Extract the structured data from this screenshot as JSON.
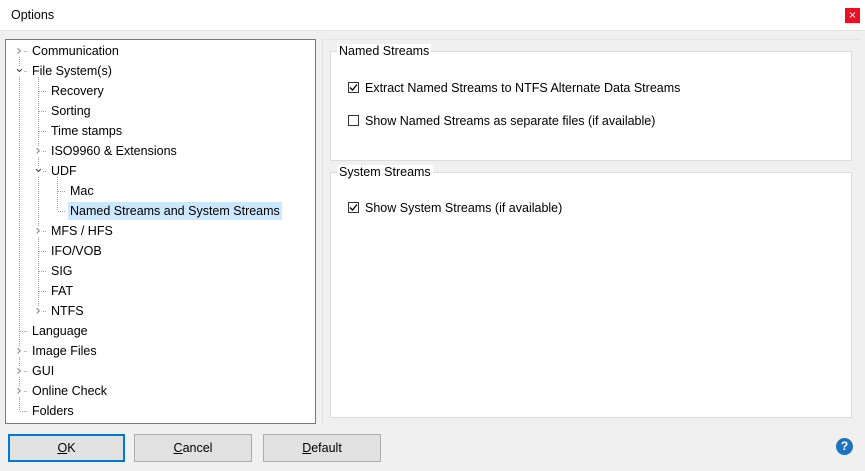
{
  "window": {
    "title": "Options",
    "close_glyph": "×"
  },
  "tree": {
    "nodes": [
      {
        "label": "Communication",
        "expander": "collapsed"
      },
      {
        "label": "File System(s)",
        "expander": "expanded"
      },
      {
        "label": "Recovery",
        "expander": "none"
      },
      {
        "label": "Sorting",
        "expander": "none"
      },
      {
        "label": "Time stamps",
        "expander": "none"
      },
      {
        "label": "ISO9960 & Extensions",
        "expander": "collapsed"
      },
      {
        "label": "UDF",
        "expander": "expanded"
      },
      {
        "label": "Mac",
        "expander": "none"
      },
      {
        "label": "Named Streams and System Streams",
        "expander": "none",
        "selected": true
      },
      {
        "label": "MFS / HFS",
        "expander": "collapsed"
      },
      {
        "label": "IFO/VOB",
        "expander": "none"
      },
      {
        "label": "SIG",
        "expander": "none"
      },
      {
        "label": "FAT",
        "expander": "none"
      },
      {
        "label": "NTFS",
        "expander": "collapsed"
      },
      {
        "label": "Language",
        "expander": "none"
      },
      {
        "label": "Image Files",
        "expander": "collapsed"
      },
      {
        "label": "GUI",
        "expander": "collapsed"
      },
      {
        "label": "Online Check",
        "expander": "collapsed"
      },
      {
        "label": "Folders",
        "expander": "none"
      }
    ]
  },
  "named_streams": {
    "title": "Named Streams",
    "extract": {
      "label": "Extract Named Streams to NTFS Alternate Data Streams",
      "checked": true
    },
    "separate": {
      "label": "Show Named Streams as separate files (if available)",
      "checked": false
    }
  },
  "system_streams": {
    "title": "System Streams",
    "show": {
      "label": "Show System Streams (if available)",
      "checked": true
    }
  },
  "buttons": {
    "ok": {
      "accel": "O",
      "rest": "K"
    },
    "cancel": {
      "accel": "C",
      "rest": "ancel"
    },
    "default": {
      "accel": "D",
      "rest": "efault"
    }
  },
  "help": {
    "glyph": "?"
  },
  "colors": {
    "selection": "#cce8ff",
    "accent": "#0078d7",
    "close": "#e81123",
    "help": "#1e73be"
  },
  "icons": {
    "close": "close-icon",
    "collapsed": "chevron-right-icon",
    "expanded": "chevron-down-icon",
    "check": "check-icon",
    "help": "help-icon"
  }
}
